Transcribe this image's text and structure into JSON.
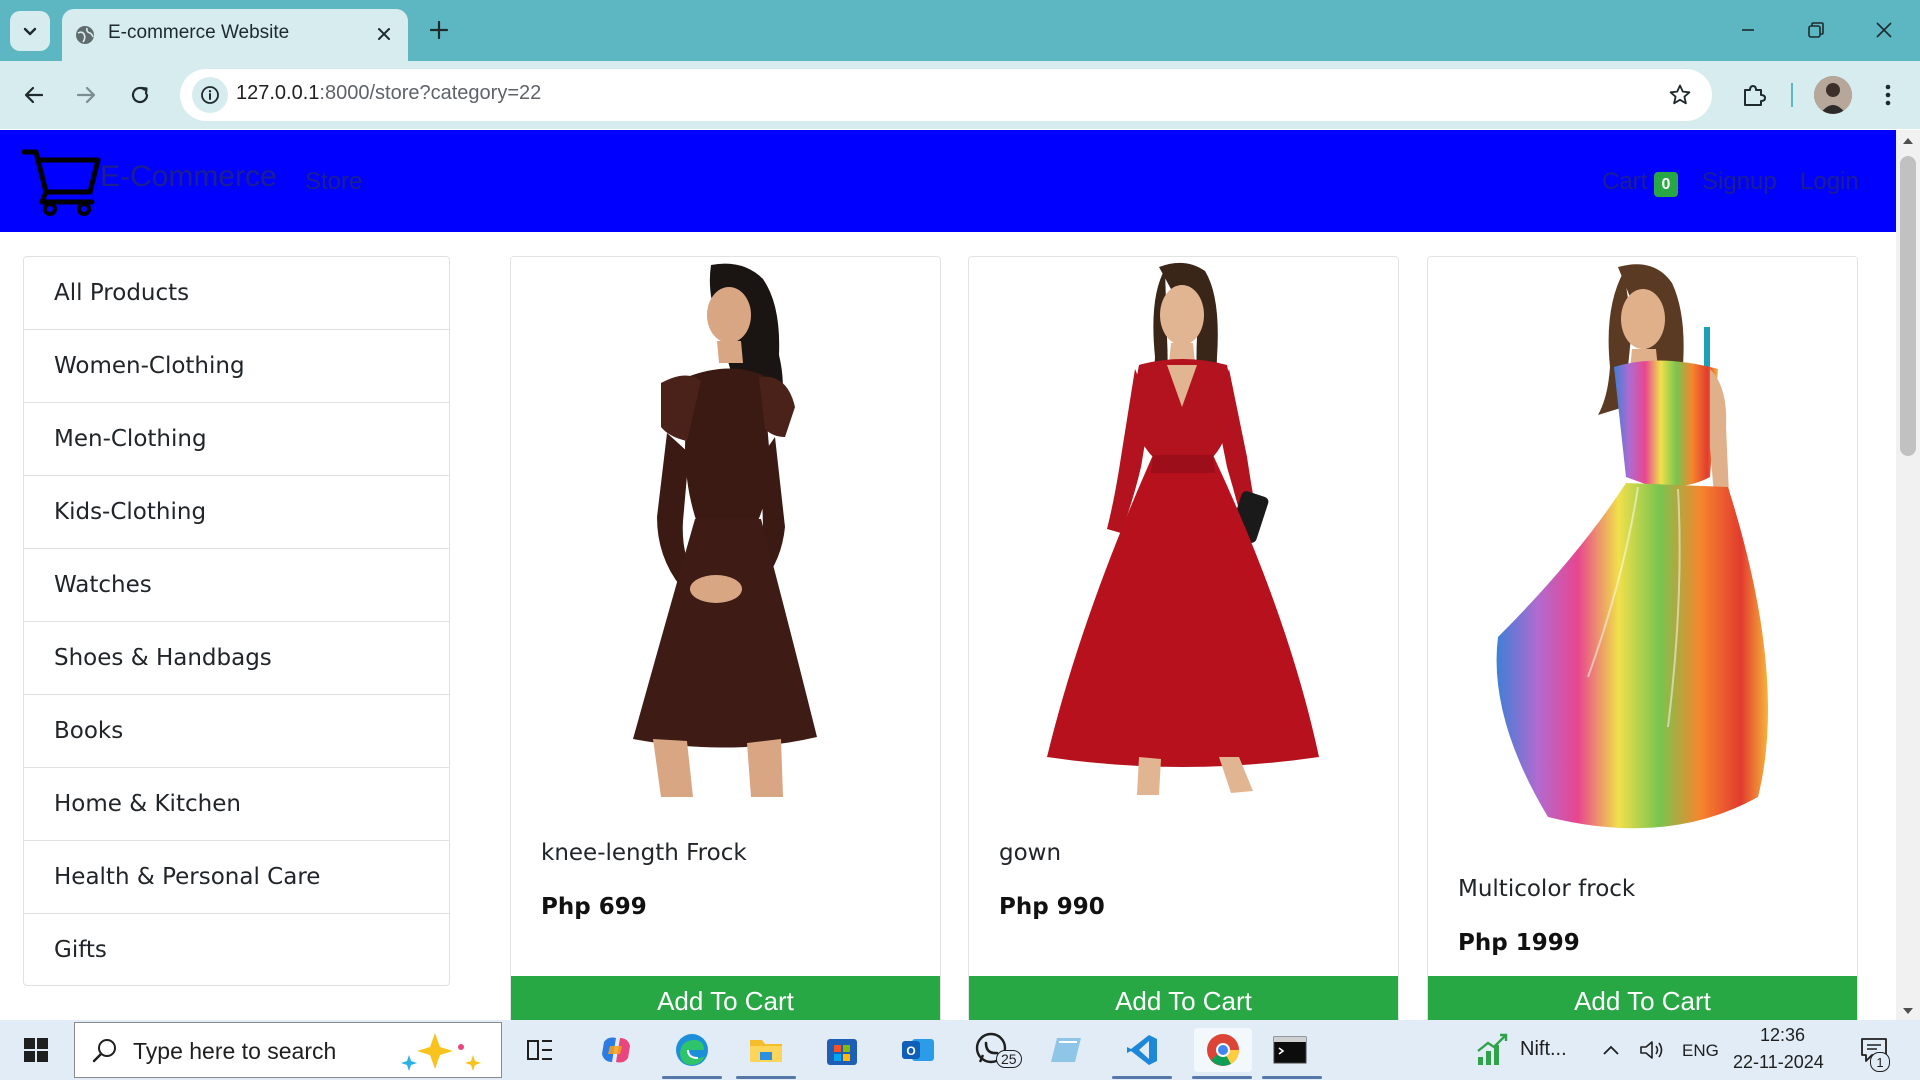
{
  "browser": {
    "tab_title": "E-commerce Website",
    "url_host": "127.0.0.1",
    "url_path": ":8000/store?category=22"
  },
  "navbar": {
    "brand": "E-Commerce",
    "store_label": "Store",
    "cart_label": "Cart",
    "cart_count": "0",
    "signup_label": "Signup",
    "login_label": "Login"
  },
  "sidebar": {
    "categories": [
      {
        "label": "All Products"
      },
      {
        "label": "Women-Clothing"
      },
      {
        "label": "Men-Clothing"
      },
      {
        "label": "Kids-Clothing"
      },
      {
        "label": "Watches"
      },
      {
        "label": "Shoes & Handbags"
      },
      {
        "label": "Books"
      },
      {
        "label": "Home & Kitchen"
      },
      {
        "label": "Health & Personal Care"
      },
      {
        "label": "Gifts"
      }
    ]
  },
  "products": [
    {
      "name": "knee-length Frock",
      "currency": "Php",
      "price": "699",
      "button": "Add To Cart"
    },
    {
      "name": "gown",
      "currency": "Php",
      "price": "990",
      "button": "Add To Cart"
    },
    {
      "name": "Multicolor frock",
      "currency": "Php",
      "price": "1999",
      "button": "Add To Cart"
    }
  ],
  "taskbar": {
    "search_placeholder": "Type here to search",
    "whatsapp_badge": "25",
    "stock_app_label": "Nift...",
    "language": "ENG",
    "time": "12:36",
    "date": "22-11-2024",
    "notification_count": "1"
  },
  "colors": {
    "navbar_bg": "#0000ff",
    "nav_text": "#1b1f8f",
    "accent_green": "#28a745",
    "chrome_tabstrip": "#5cb7c2",
    "chrome_toolbar": "#d6ecef"
  }
}
